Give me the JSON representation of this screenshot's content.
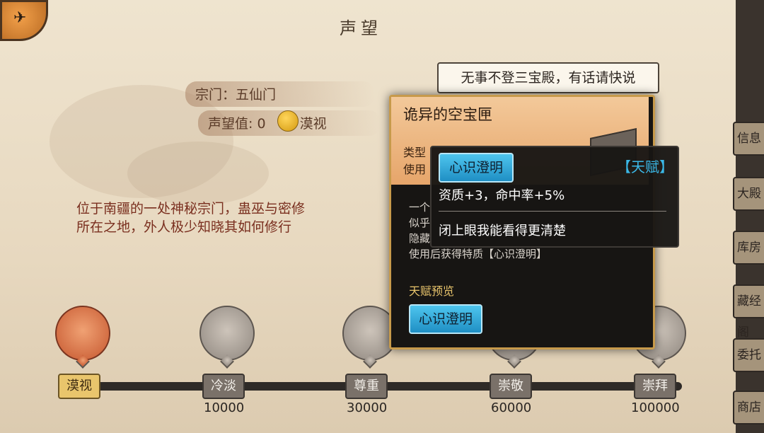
{
  "header": {
    "title": "声望"
  },
  "sect": {
    "name_label": "宗门：五仙门",
    "rep_label": "声望值: 0",
    "rep_status": "漠视",
    "description": "位于南疆的一处神秘宗门，蛊巫与密修所在之地，外人极少知晓其如何修行"
  },
  "speech": {
    "text": "无事不登三宝殿，有话请快说"
  },
  "right_tabs": [
    "信息",
    "大殿",
    "库房",
    "藏经阁",
    "委托",
    "商店"
  ],
  "tiers": [
    {
      "label": "漠视",
      "value": ""
    },
    {
      "label": "冷淡",
      "value": "10000"
    },
    {
      "label": "尊重",
      "value": "30000"
    },
    {
      "label": "崇敬",
      "value": "60000"
    },
    {
      "label": "崇拜",
      "value": "100000"
    }
  ],
  "current_tier_index": 0,
  "item_dialog": {
    "title": "诡异的空宝匣",
    "type_label": "类型",
    "use_label": "使用",
    "body_line1": "一个",
    "body_line2": "似乎",
    "body_line3": "隐藏",
    "body_line4": "使用后获得特质【心识澄明】",
    "preview_label": "天赋预览",
    "preview_button": "心识澄明"
  },
  "tooltip": {
    "trait_name": "心识澄明",
    "tag": "【天赋】",
    "stats": "资质+3，命中率+5%",
    "flavor": "闭上眼我能看得更清楚"
  },
  "colors": {
    "accent_gold": "#c79a4b",
    "trait_blue": "#3bb9e8",
    "active_tier": "#e9c56c"
  }
}
